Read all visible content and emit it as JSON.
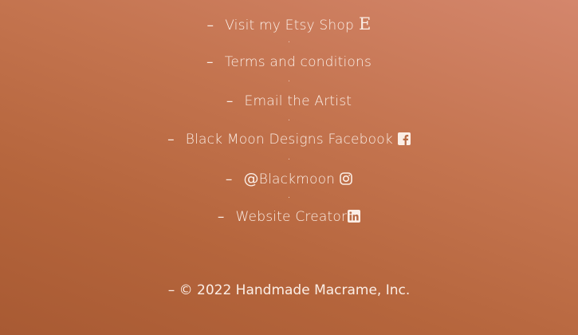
{
  "footer": {
    "links": {
      "etsy": {
        "dash": "–",
        "label": "Visit my Etsy Shop",
        "icon": "etsy-icon",
        "glyph": "E"
      },
      "terms": {
        "dash": "–",
        "label": "Terms and conditions"
      },
      "email": {
        "dash": "–",
        "label": "Email the Artist"
      },
      "facebook": {
        "dash": "–",
        "label": "Black Moon Designs Facebook",
        "icon": "facebook-icon"
      },
      "instagram": {
        "dash": "–",
        "at": "@",
        "label": "Blackmoon",
        "icon": "instagram-icon"
      },
      "website": {
        "dash": "–",
        "label": "Website Creator",
        "icon": "linkedin-icon"
      }
    },
    "separator": ".",
    "copyright": "– © 2022 Handmade Macrame, Inc."
  },
  "colors": {
    "text": "#fbeee6",
    "background_top": "#d4866c",
    "background_bottom": "#a85a33"
  }
}
